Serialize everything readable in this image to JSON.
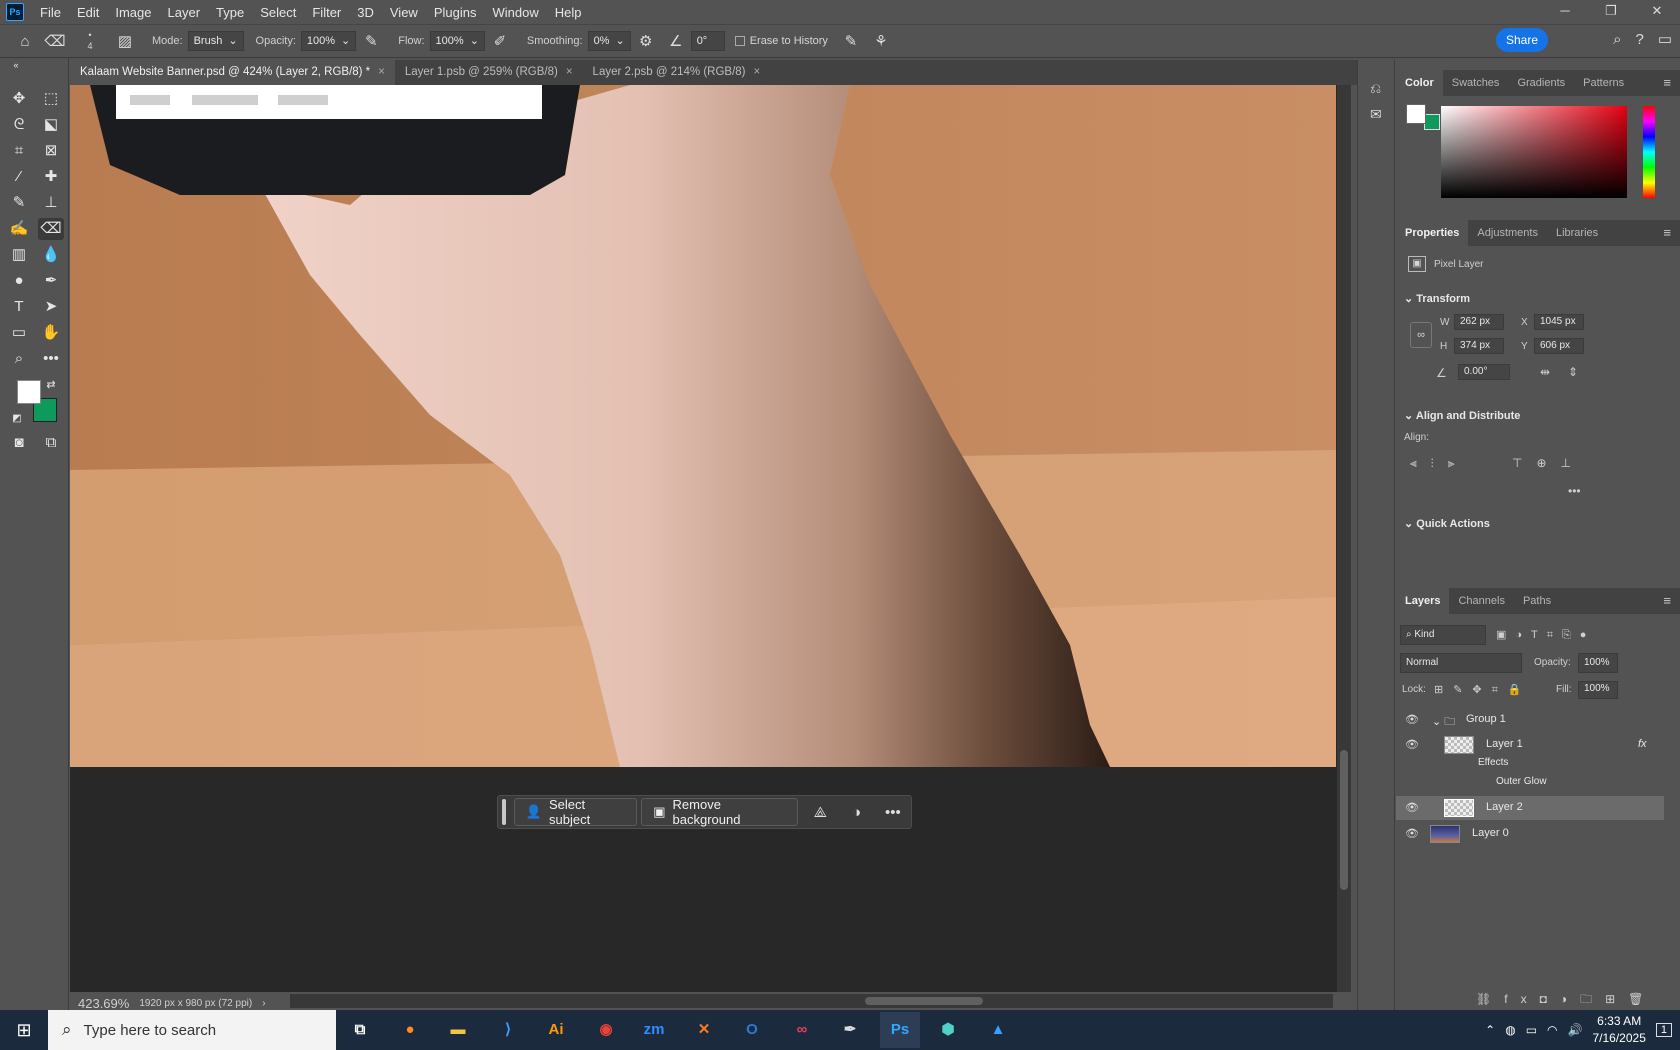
{
  "app": {
    "logo": "Ps"
  },
  "menu": [
    "File",
    "Edit",
    "Image",
    "Layer",
    "Type",
    "Select",
    "Filter",
    "3D",
    "View",
    "Plugins",
    "Window",
    "Help"
  ],
  "options": {
    "brush_size": "4",
    "mode_label": "Mode:",
    "mode_value": "Brush",
    "opacity_label": "Opacity:",
    "opacity_value": "100%",
    "flow_label": "Flow:",
    "flow_value": "100%",
    "smoothing_label": "Smoothing:",
    "smoothing_value": "0%",
    "angle_value": "0°",
    "erase_history_label": "Erase to History",
    "share_label": "Share"
  },
  "tabs": [
    {
      "label": "Kalaam Website Banner.psd @ 424% (Layer 2, RGB/8) *",
      "active": true
    },
    {
      "label": "Layer 1.psb @ 259% (RGB/8)",
      "active": false
    },
    {
      "label": "Layer 2.psb @ 214% (RGB/8)",
      "active": false
    }
  ],
  "status": {
    "zoom": "423.69%",
    "doc_size": "1920 px x 980 px (72 ppi)"
  },
  "task_bar": {
    "select_subject": "Select subject",
    "remove_background": "Remove background"
  },
  "colors": {
    "foreground": "#ffffff",
    "background": "#0e9a5a",
    "accent": "#1473e6"
  },
  "color_panel": {
    "tabs": [
      "Color",
      "Swatches",
      "Gradients",
      "Patterns"
    ],
    "active": "Color"
  },
  "properties_panel": {
    "tabs": [
      "Properties",
      "Adjustments",
      "Libraries"
    ],
    "active": "Properties",
    "layer_type": "Pixel Layer",
    "transform_label": "Transform",
    "w_label": "W",
    "w": "262 px",
    "h_label": "H",
    "h": "374 px",
    "x_label": "X",
    "x": "1045 px",
    "y_label": "Y",
    "y": "606 px",
    "angle": "0.00°",
    "align_label": "Align and Distribute",
    "align_sub": "Align:",
    "quick_actions": "Quick Actions"
  },
  "layers_panel": {
    "tabs": [
      "Layers",
      "Channels",
      "Paths"
    ],
    "active": "Layers",
    "kind": "Kind",
    "blend": "Normal",
    "opacity_label": "Opacity:",
    "opacity": "100%",
    "lock_label": "Lock:",
    "fill_label": "Fill:",
    "fill": "100%",
    "layers": {
      "group": "Group 1",
      "layer1": "Layer 1",
      "effects": "Effects",
      "outer_glow": "Outer Glow",
      "layer2": "Layer 2",
      "layer0": "Layer 0"
    },
    "selected": "Layer 2"
  },
  "taskbar": {
    "search_placeholder": "Type here to search",
    "apps": [
      "task-view",
      "firefox",
      "file-explorer",
      "vscode",
      "illustrator",
      "chrome",
      "zoom",
      "xampp",
      "outlook",
      "creative-cloud",
      "pen-tool",
      "photoshop",
      "app",
      "app"
    ],
    "time": "6:33 AM",
    "date": "7/16/2025",
    "notifications": "1"
  }
}
